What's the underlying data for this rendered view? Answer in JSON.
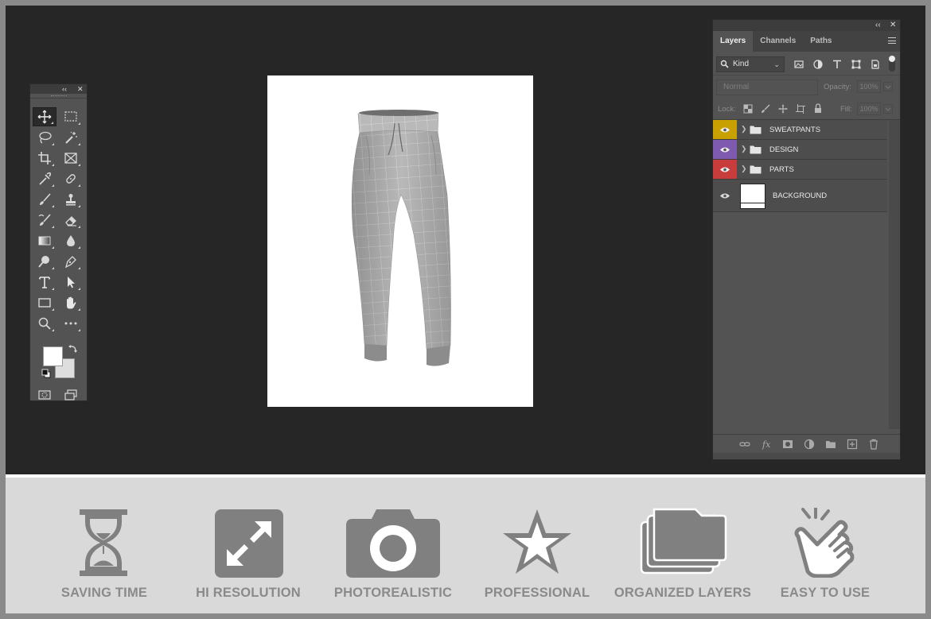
{
  "layers_panel": {
    "tabs": [
      {
        "label": "Layers",
        "active": true
      },
      {
        "label": "Channels",
        "active": false
      },
      {
        "label": "Paths",
        "active": false
      }
    ],
    "filter": {
      "kind_label": "Kind"
    },
    "blend_mode": "Normal",
    "opacity_label": "Opacity:",
    "opacity_value": "100%",
    "lock_label": "Lock:",
    "fill_label": "Fill:",
    "fill_value": "100%",
    "layers": [
      {
        "name": "SWEATPANTS",
        "type": "group",
        "color": "#c8a000",
        "visible": true
      },
      {
        "name": "DESIGN",
        "type": "group",
        "color": "#7f5bb0",
        "visible": true
      },
      {
        "name": "PARTS",
        "type": "group",
        "color": "#c83c3c",
        "visible": true
      },
      {
        "name": "BACKGROUND",
        "type": "layer",
        "color": "",
        "visible": true
      }
    ]
  },
  "tools_panel": {
    "foreground_color": "#ffffff",
    "background_color": "#dedede"
  },
  "features": [
    {
      "label": "SAVING TIME",
      "icon": "hourglass-icon"
    },
    {
      "label": "HI RESOLUTION",
      "icon": "expand-arrows-icon"
    },
    {
      "label": "PHOTOREALISTIC",
      "icon": "camera-icon"
    },
    {
      "label": "PROFESSIONAL",
      "icon": "star-icon"
    },
    {
      "label": "ORGANIZED LAYERS",
      "icon": "stacked-folders-icon"
    },
    {
      "label": "EASY TO USE",
      "icon": "pointing-hand-icon"
    }
  ],
  "colors": {
    "workspace_bg": "#262626",
    "panel_bg": "#535353",
    "feature_bar_bg": "#d9d9d9",
    "feature_icon": "#808080"
  }
}
